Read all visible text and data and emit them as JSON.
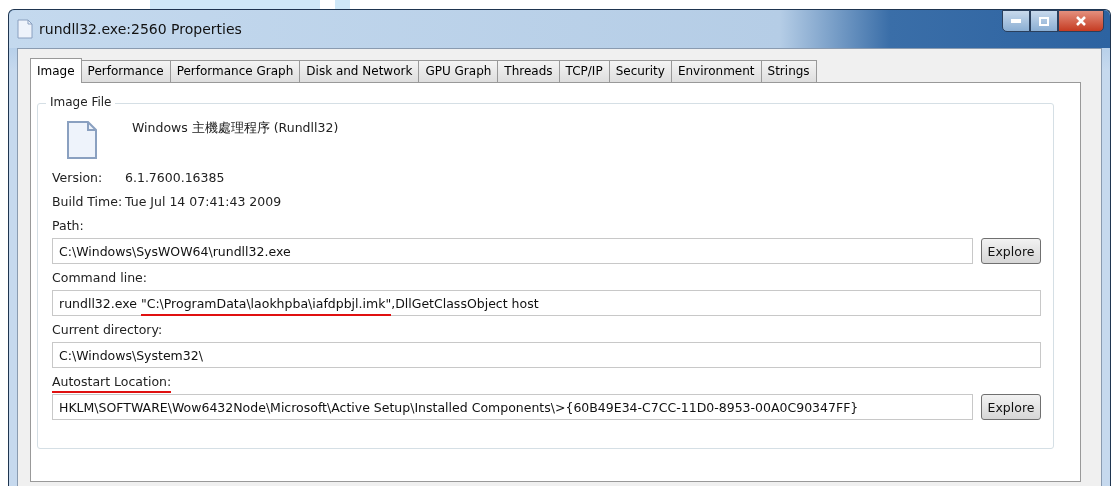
{
  "window": {
    "title": "rundll32.exe:2560 Properties"
  },
  "tabs": [
    {
      "label": "Image",
      "selected": true
    },
    {
      "label": "Performance",
      "selected": false
    },
    {
      "label": "Performance Graph",
      "selected": false
    },
    {
      "label": "Disk and Network",
      "selected": false
    },
    {
      "label": "GPU Graph",
      "selected": false
    },
    {
      "label": "Threads",
      "selected": false
    },
    {
      "label": "TCP/IP",
      "selected": false
    },
    {
      "label": "Security",
      "selected": false
    },
    {
      "label": "Environment",
      "selected": false
    },
    {
      "label": "Strings",
      "selected": false
    }
  ],
  "group": {
    "title": "Image File",
    "description": "Windows 主機處理程序 (Rundll32)",
    "info": [
      {
        "label": "Version:",
        "value": "6.1.7600.16385"
      },
      {
        "label": "Build Time:",
        "value": "Tue Jul 14 07:41:43 2009"
      }
    ],
    "fields": [
      {
        "label": "Path:",
        "label_marked": false,
        "parts": [
          {
            "text": "C:\\Windows\\SysWOW64\\rundll32.exe",
            "marked": false
          }
        ],
        "button": "Explore"
      },
      {
        "label": "Command line:",
        "label_marked": false,
        "parts": [
          {
            "text": "rundll32.exe ",
            "marked": false
          },
          {
            "text": "\"C:\\ProgramData\\laokhpba\\iafdpbjl.imk\"",
            "marked": true
          },
          {
            "text": ",DllGetClassObject host",
            "marked": false
          }
        ]
      },
      {
        "label": "Current directory:",
        "label_marked": false,
        "parts": [
          {
            "text": "C:\\Windows\\System32\\",
            "marked": false
          }
        ]
      },
      {
        "label": "Autostart Location:",
        "label_marked": true,
        "parts": [
          {
            "text": "HKLM\\SOFTWARE\\Wow6432Node\\Microsoft\\Active Setup\\Installed Components\\>{60B49E34-C7CC-11D0-8953-00A0C90347FF}",
            "marked": false
          }
        ],
        "button": "Explore"
      }
    ]
  }
}
